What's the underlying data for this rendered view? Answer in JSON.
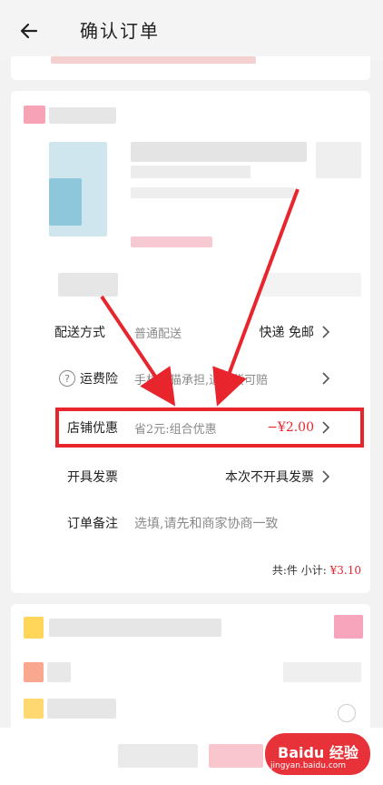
{
  "header": {
    "title": "确认订单",
    "back_icon": "arrow-left-icon"
  },
  "order_rows": [
    {
      "label": "配送方式",
      "desc": "普通配送",
      "value": "快递 免邮"
    },
    {
      "label": "运费险",
      "desc": "手机天猫承担,退换货可赔",
      "value": ""
    },
    {
      "label": "店铺优惠",
      "desc": "省2元:组合优惠",
      "value": "−¥2.00"
    },
    {
      "label": "开具发票",
      "desc": "",
      "value": "本次不开具发票"
    },
    {
      "label": "订单备注",
      "desc": "选填,请先和商家协商一致",
      "value": ""
    }
  ],
  "subtotal": {
    "count_label": "共:件",
    "subtotal_label": "小计:",
    "price": "¥3.10"
  },
  "watermark": {
    "main": "Baidu 经验",
    "sub": "jingyan.baidu.com"
  },
  "colors": {
    "accent": "#e8242c",
    "background": "#f2f2f2"
  }
}
